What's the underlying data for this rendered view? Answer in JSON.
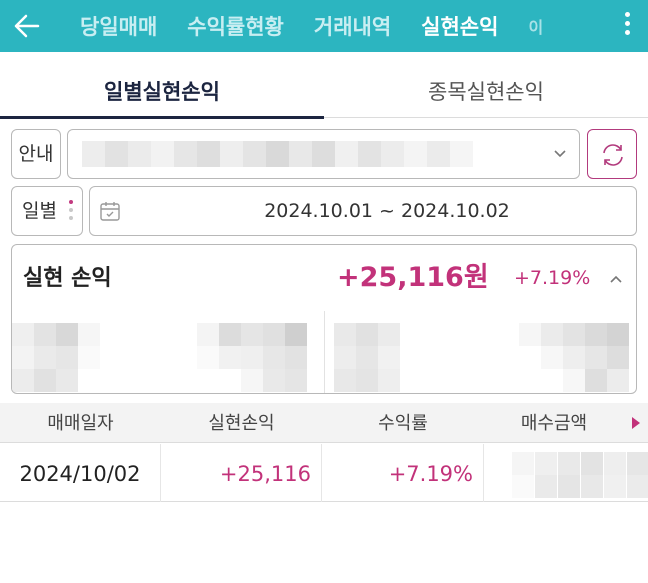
{
  "header": {
    "tabs": [
      {
        "label": "당일매매"
      },
      {
        "label": "수익률현황"
      },
      {
        "label": "거래내역"
      },
      {
        "label": "실현손익"
      },
      {
        "label": "이"
      }
    ],
    "active_tab": "실현손익",
    "theme_color": "#2cb5c0"
  },
  "subtabs": [
    {
      "label": "일별실현손익"
    },
    {
      "label": "종목실현손익"
    }
  ],
  "account": {
    "info_label": "안내"
  },
  "period": {
    "label": "일별",
    "date_range": "2024.10.01 ~ 2024.10.02"
  },
  "summary": {
    "title": "실현 손익",
    "amount": "+25,116원",
    "rate": "+7.19%"
  },
  "table": {
    "columns": [
      "매매일자",
      "실현손익",
      "수익률",
      "매수금액"
    ],
    "rows": [
      {
        "date": "2024/10/02",
        "pnl": "+25,116",
        "rate": "+7.19%"
      }
    ]
  },
  "colors": {
    "accent": "#2cb5c0",
    "profit": "#c2327a",
    "active_subtab": "#1c2540"
  }
}
